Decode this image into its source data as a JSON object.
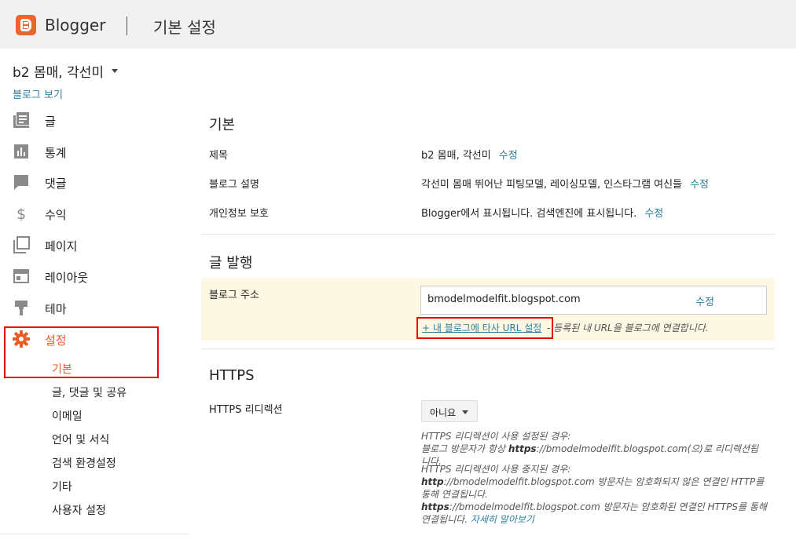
{
  "header": {
    "app_title": "Blogger",
    "page_title": "기본 설정"
  },
  "sidebar": {
    "blog_name": "b2 몸매, 각선미",
    "view_blog": "블로그 보기",
    "items": [
      {
        "label": "글",
        "icon": "posts-icon"
      },
      {
        "label": "통계",
        "icon": "stats-icon"
      },
      {
        "label": "댓글",
        "icon": "comments-icon"
      },
      {
        "label": "수익",
        "icon": "dollar-icon"
      },
      {
        "label": "페이지",
        "icon": "pages-icon"
      },
      {
        "label": "레이아웃",
        "icon": "layout-icon"
      },
      {
        "label": "테마",
        "icon": "theme-icon"
      },
      {
        "label": "설정",
        "icon": "gear-icon"
      }
    ],
    "settings_sub": [
      "기본",
      "글, 댓글 및 공유",
      "이메일",
      "언어 및 서식",
      "검색 환경설정",
      "기타",
      "사용자 설정"
    ]
  },
  "main": {
    "basic": {
      "title": "기본",
      "title_label": "제목",
      "title_value": "b2 몸매, 각선미",
      "desc_label": "블로그 설명",
      "desc_value": "각선미 몸매 뛰어난 피팅모델, 레이싱모델, 인스타그램 여신들",
      "privacy_label": "개인정보 보호",
      "privacy_value": "Blogger에서 표시됩니다. 검색엔진에 표시됩니다.",
      "edit": "수정"
    },
    "publishing": {
      "title": "글 발행",
      "address_label": "블로그 주소",
      "address_value": "bmodelmodelfit.blogspot.com",
      "edit": "수정",
      "custom_url_link": "+ 내 블로그에 타사 URL 설정",
      "custom_url_desc": "- 등록된 내 URL을 블로그에 연결합니다."
    },
    "https": {
      "title": "HTTPS",
      "redirect_label": "HTTPS 리디렉션",
      "redirect_value": "아니요",
      "help1_line1": "HTTPS 리디렉션이 사용 설정된 경우:",
      "help1_pre": "블로그 방문자가 항상 ",
      "help1_url": "https",
      "help1_post": "://bmodelmodelfit.blogspot.com(으)로 리디렉션됩니다.",
      "help2_line1": "HTTPS 리디렉션이 사용 중지된 경우:",
      "help2_http": "http",
      "help2_http_rest": "://bmodelmodelfit.blogspot.com 방문자는 암호화되지 않은 연결인 HTTP를 통해 연결됩니다.",
      "help2_https": "https",
      "help2_https_rest": "://bmodelmodelfit.blogspot.com 방문자는 암호화된 연결인 HTTPS를 통해 연결됩니다. ",
      "help2_link": "자세히 알아보기"
    }
  }
}
